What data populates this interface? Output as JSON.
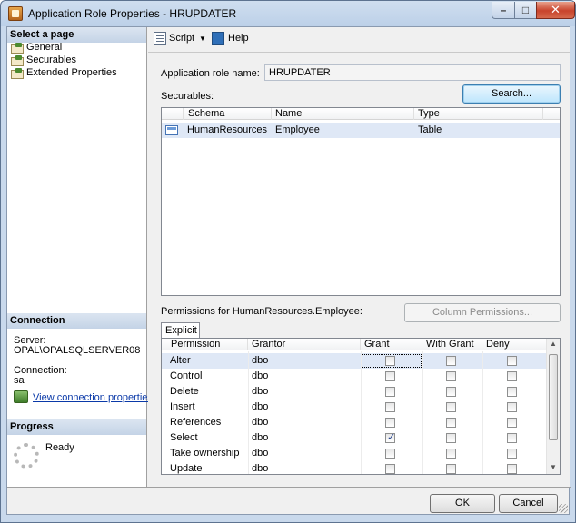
{
  "window": {
    "title": "Application Role Properties - HRUPDATER"
  },
  "left_pane": {
    "select_page_header": "Select a page",
    "pages": [
      {
        "label": "General",
        "icon": "page-icon"
      },
      {
        "label": "Securables",
        "icon": "page-icon"
      },
      {
        "label": "Extended Properties",
        "icon": "page-icon"
      }
    ],
    "connection": {
      "header": "Connection",
      "server_label": "Server:",
      "server_value": "OPAL\\OPALSQLSERVER08",
      "connection_label": "Connection:",
      "connection_value": "sa",
      "view_link": "View connection properties"
    },
    "progress": {
      "header": "Progress",
      "status": "Ready"
    }
  },
  "toolbar": {
    "script_label": "Script",
    "help_label": "Help"
  },
  "form": {
    "role_name_label": "Application role name:",
    "role_name_value": "HRUPDATER",
    "securables_label": "Securables:",
    "search_button": "Search...",
    "securables_grid": {
      "columns": [
        "Schema",
        "Name",
        "Type"
      ],
      "rows": [
        {
          "schema": "HumanResources",
          "name": "Employee",
          "type": "Table"
        }
      ]
    },
    "permissions_label": "Permissions for HumanResources.Employee:",
    "column_permissions_button": "Column Permissions...",
    "tab_label": "Explicit",
    "permissions_grid": {
      "columns": [
        "Permission",
        "Grantor",
        "Grant",
        "With Grant",
        "Deny"
      ],
      "rows": [
        {
          "permission": "Alter",
          "grantor": "dbo",
          "grant": false,
          "with_grant": false,
          "deny": false
        },
        {
          "permission": "Control",
          "grantor": "dbo",
          "grant": false,
          "with_grant": false,
          "deny": false
        },
        {
          "permission": "Delete",
          "grantor": "dbo",
          "grant": false,
          "with_grant": false,
          "deny": false
        },
        {
          "permission": "Insert",
          "grantor": "dbo",
          "grant": false,
          "with_grant": false,
          "deny": false
        },
        {
          "permission": "References",
          "grantor": "dbo",
          "grant": false,
          "with_grant": false,
          "deny": false
        },
        {
          "permission": "Select",
          "grantor": "dbo",
          "grant": true,
          "with_grant": false,
          "deny": false
        },
        {
          "permission": "Take ownership",
          "grantor": "dbo",
          "grant": false,
          "with_grant": false,
          "deny": false
        },
        {
          "permission": "Update",
          "grantor": "dbo",
          "grant": false,
          "with_grant": false,
          "deny": false
        }
      ]
    }
  },
  "footer": {
    "ok_button": "OK",
    "cancel_button": "Cancel"
  }
}
